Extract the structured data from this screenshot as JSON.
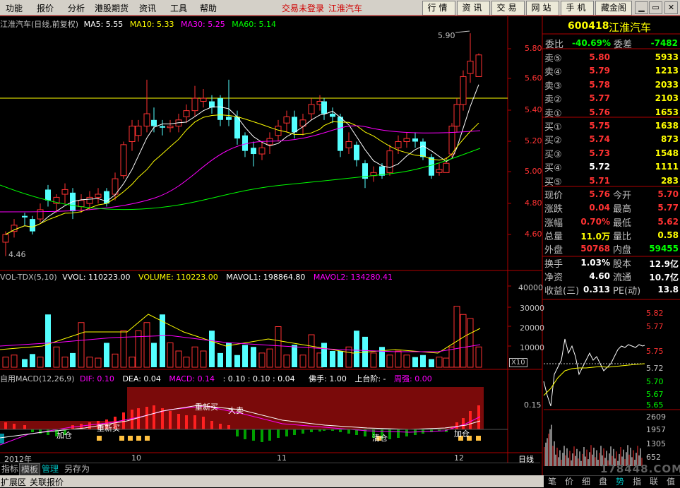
{
  "menu": {
    "items": [
      "功能",
      "报价",
      "分析",
      "港股期货",
      "资讯",
      "工具",
      "帮助"
    ],
    "status": "交易未登录",
    "stock_name": "江淮汽车",
    "right_buttons": [
      "行情",
      "资讯",
      "交易",
      "网站",
      "手机",
      "藏金阁"
    ],
    "window_buttons": [
      "▁",
      "▭",
      "✕"
    ]
  },
  "kline": {
    "title": "江淮汽车(日线,前复权)",
    "ma5": "MA5: 5.55",
    "ma10": "MA10: 5.33",
    "ma30": "MA30: 5.25",
    "ma60": "MA60: 5.14",
    "high_label": "5.90",
    "low_label": "4.46",
    "price_ticks": [
      "5.80",
      "5.60",
      "5.40",
      "5.20",
      "5.00",
      "4.80",
      "4.60"
    ],
    "colors": {
      "up": "#ff3232",
      "down": "#54ffff",
      "ma5": "#ffffff",
      "ma10": "#ffff00",
      "ma30": "#ff00ff",
      "ma60": "#00ff00"
    }
  },
  "volume": {
    "title": "VOL-TDX(5,10)",
    "vvol": "VVOL: 110223.00",
    "volume": "VOLUME: 110223.00",
    "mavol1": "MAVOL1: 198864.80",
    "mavol2": "MAVOL2: 134280.41",
    "ticks": [
      "40000",
      "30000",
      "20000",
      "10000"
    ],
    "unit": "X10"
  },
  "macd": {
    "title": "自用MACD(12,26,9)",
    "dif": "DIF: 0.10",
    "dea": "DEA: 0.04",
    "macd": "MACD: 0.14",
    "extra": ": 0.10 : 0.10 : 0.04",
    "foshou": "佛手: 1.00",
    "shangtai": "上台阶: -",
    "zhouqiang": "周强: 0.00",
    "tick": "0.15",
    "annotations": [
      "加仓",
      "重新买",
      "重新买",
      "大卖",
      "清仓",
      "加仓"
    ]
  },
  "time_axis": {
    "labels": [
      "2012年",
      "10",
      "11",
      "12"
    ],
    "period": "日线"
  },
  "bottom_tabs": [
    "指标",
    "模板",
    "管理",
    "另存为"
  ],
  "status_tabs": [
    "扩展区",
    "关联报价"
  ],
  "quote": {
    "code": "600418",
    "name": "江淮汽车",
    "weibi_label": "委比",
    "weibi": "-40.69%",
    "weicha_label": "委差",
    "weicha": "-7482",
    "sell": [
      {
        "label": "卖⑤",
        "price": "5.80",
        "vol": "5933"
      },
      {
        "label": "卖④",
        "price": "5.79",
        "vol": "1213"
      },
      {
        "label": "卖③",
        "price": "5.78",
        "vol": "2033"
      },
      {
        "label": "卖②",
        "price": "5.77",
        "vol": "2103"
      },
      {
        "label": "卖①",
        "price": "5.76",
        "vol": "1653"
      }
    ],
    "buy": [
      {
        "label": "买①",
        "price": "5.75",
        "vol": "1638"
      },
      {
        "label": "买②",
        "price": "5.74",
        "vol": "873"
      },
      {
        "label": "买③",
        "price": "5.73",
        "vol": "1548"
      },
      {
        "label": "买④",
        "price": "5.72",
        "vol": "1111"
      },
      {
        "label": "买⑤",
        "price": "5.71",
        "vol": "283"
      }
    ],
    "stats": [
      {
        "l1": "现价",
        "v1": "5.76",
        "l2": "今开",
        "v2": "5.70"
      },
      {
        "l1": "涨跌",
        "v1": "0.04",
        "l2": "最高",
        "v2": "5.77"
      },
      {
        "l1": "涨幅",
        "v1": "0.70%",
        "l2": "最低",
        "v2": "5.62"
      },
      {
        "l1": "总量",
        "v1": "11.0万",
        "l2": "量比",
        "v2": "0.58"
      },
      {
        "l1": "外盘",
        "v1": "50768",
        "l2": "内盘",
        "v2": "59455"
      },
      {
        "l1": "换手",
        "v1": "1.03%",
        "l2": "股本",
        "v2": "12.9亿"
      },
      {
        "l1": "净资",
        "v1": "4.60",
        "l2": "流通",
        "v2": "10.7亿"
      },
      {
        "l1": "收益(三)",
        "v1": "0.313",
        "l2": "PE(动)",
        "v2": "13.8"
      }
    ]
  },
  "mini_chart": {
    "price_ticks": [
      "5.82",
      "5.77",
      "5.75",
      "5.72",
      "5.70",
      "5.67",
      "5.65"
    ],
    "vol_ticks": [
      "2609",
      "1957",
      "1305",
      "652"
    ],
    "tabs": [
      "笔",
      "价",
      "细",
      "盘",
      "势",
      "指",
      "联",
      "值"
    ],
    "watermark": "178448.COM"
  }
}
